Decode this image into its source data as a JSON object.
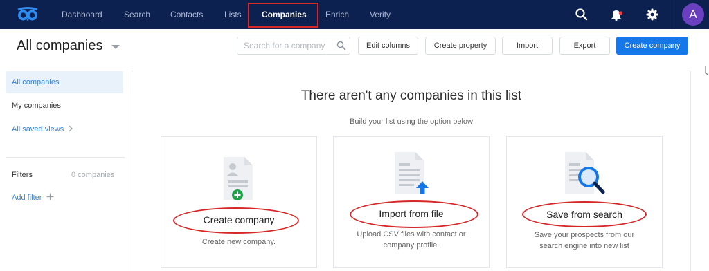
{
  "nav": {
    "items": [
      "Dashboard",
      "Search",
      "Contacts",
      "Lists",
      "Companies",
      "Enrich",
      "Verify"
    ],
    "active": "Companies",
    "icons": [
      "search-icon",
      "bell-icon",
      "gear-icon"
    ],
    "avatar_letter": "A"
  },
  "header": {
    "title": "All companies",
    "search_placeholder": "Search for a company",
    "buttons": {
      "edit_columns": "Edit columns",
      "create_property": "Create property",
      "import": "Import",
      "export": "Export",
      "create_company": "Create company"
    }
  },
  "sidebar": {
    "items": [
      "All companies",
      "My companies",
      "All saved views"
    ],
    "filters_label": "Filters",
    "filters_count": "0 companies",
    "add_filter": "Add filter"
  },
  "empty": {
    "title": "There aren't any companies in this list",
    "subtitle": "Build your list using the option below"
  },
  "cards": [
    {
      "title": "Create company",
      "desc_lines": [
        "Create new company."
      ]
    },
    {
      "title": "Import from file",
      "desc_lines": [
        "Upload CSV files with contact or",
        "company profile."
      ]
    },
    {
      "title": "Save from search",
      "desc_lines": [
        "Save your prospects from our",
        "search engine into new list"
      ]
    }
  ],
  "colors": {
    "nav_bg": "#0d2151",
    "accent": "#1677e8",
    "annotation": "#d62728",
    "avatar": "#6a3fc0"
  }
}
